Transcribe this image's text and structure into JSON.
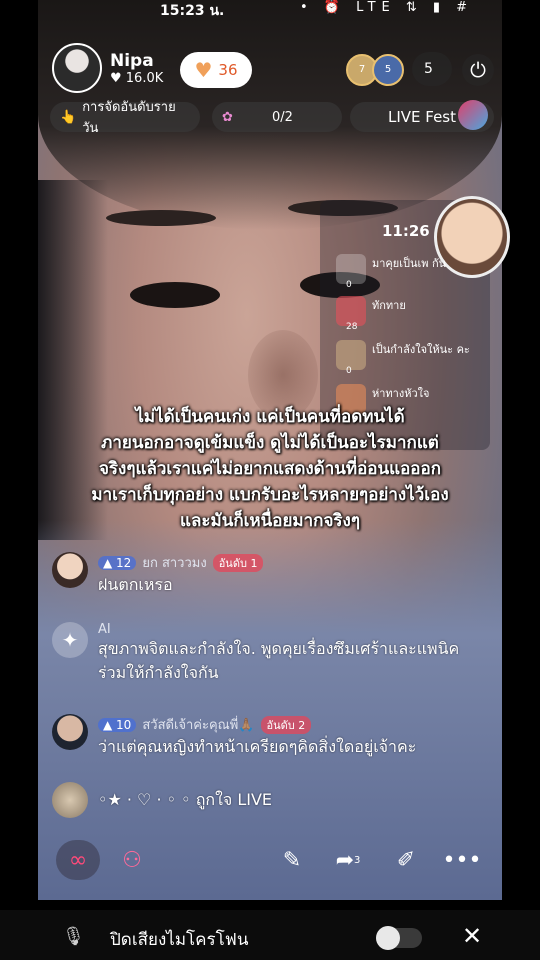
{
  "status_bar": {
    "time": "15:23 น.",
    "icons": "• ⏰ LTE ⇅ ▮ #"
  },
  "host": {
    "name": "Nipa",
    "likes": "♥ 16.0K"
  },
  "likes_pill": {
    "count": "36"
  },
  "viewers": {
    "badge1": "7",
    "badge2": "5",
    "count": "5"
  },
  "rank_pill": {
    "label": "การจัดอันดับรายวัน",
    "icon": "fire-icon"
  },
  "gift_pill": {
    "progress": "0/2"
  },
  "fest_pill": {
    "label": "LIVE Fest"
  },
  "side_panel": {
    "time": "11:26",
    "items": [
      {
        "text": "มาคุยเป็นเพ กัน",
        "count": "0"
      },
      {
        "text": "ทักทาย",
        "count": "28"
      },
      {
        "text": "เป็นกำลังใจให้นะ คะ",
        "count": "0"
      },
      {
        "text": "ห่าทางหัวใจ",
        "count": ""
      }
    ]
  },
  "caption": [
    "ไม่ได้เป็นคนเก่ง แค่เป็นคนที่อดทนได้",
    "ภายนอกอาจดูเข้มแข็ง ดูไม่ได้เป็นอะไรมากแต่",
    "จริงๆแล้วเราแค่ไม่อยากแสดงด้านที่อ่อนแอออก",
    "มาเราเก็บทุกอย่าง แบกรับอะไรหลายๆอย่างไว้เอง",
    "และมันก็เหนื่อยมากจริงๆ"
  ],
  "comments": [
    {
      "level": "12",
      "user": "ยก สาววมง",
      "rank": "อันดับ 1",
      "text": "ฝนตกเหรอ"
    },
    {
      "level": "",
      "user": "AI",
      "rank": "",
      "text": "สุขภาพจิตและกำลังใจ. พูดคุยเรื่องซึมเศร้าและแพนิค ร่วมให้กำลังใจกัน"
    },
    {
      "level": "10",
      "user": "สวัสดีเจ้าค่ะคุณพี่🙏🏽",
      "rank": "อันดับ 2",
      "text": "ว่าแต่คุณหญิงทำหน้าเครียดๆคิดสิ่งใดอยู่เจ้าคะ"
    },
    {
      "level": "",
      "user": "",
      "rank": "",
      "text": "◦★ · ♡ · ◦ ◦ ถูกใจ LIVE"
    }
  ],
  "toolbar": {
    "share_count": "3"
  },
  "bottom_bar": {
    "mute_label": "ปิดเสียงไมโครโฟน",
    "close": "✕"
  }
}
